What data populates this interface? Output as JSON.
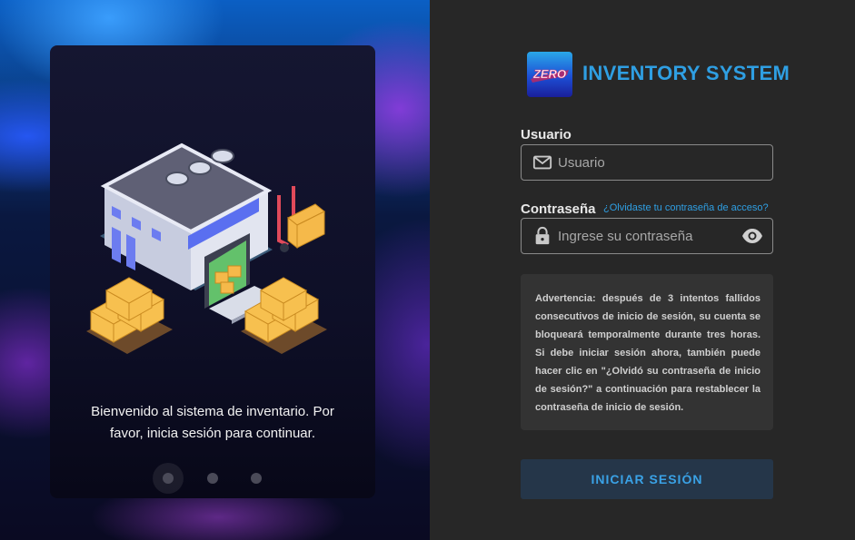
{
  "brand": {
    "logo_text": "ZERO",
    "title": "INVENTORY SYSTEM"
  },
  "left_panel": {
    "welcome_text": "Bienvenido al sistema de inventario. Por favor, inicia sesión para continuar.",
    "carousel": {
      "total": 3,
      "active": 1
    }
  },
  "form": {
    "username": {
      "label": "Usuario",
      "placeholder": "Usuario",
      "value": ""
    },
    "password": {
      "label": "Contraseña",
      "placeholder": "Ingrese su contraseña",
      "value": "",
      "forgot_link": "¿Olvidaste tu contraseña de acceso?"
    },
    "warning": "Advertencia: después de 3 intentos fallidos consecutivos de inicio de sesión, su cuenta se bloqueará temporalmente durante tres horas. Si debe iniciar sesión ahora, también puede hacer clic en \"¿Olvidó su contraseña de inicio de sesión?\" a continuación para restablecer la contraseña de inicio de sesión.",
    "submit_label": "INICIAR SESIÓN"
  },
  "colors": {
    "accent": "#2f9fe3",
    "panel_bg": "#272727",
    "button_bg": "#253649",
    "warning_bg": "#333333"
  },
  "icons": {
    "username": "mail-icon",
    "password": "lock-icon",
    "toggle": "eye-icon"
  }
}
